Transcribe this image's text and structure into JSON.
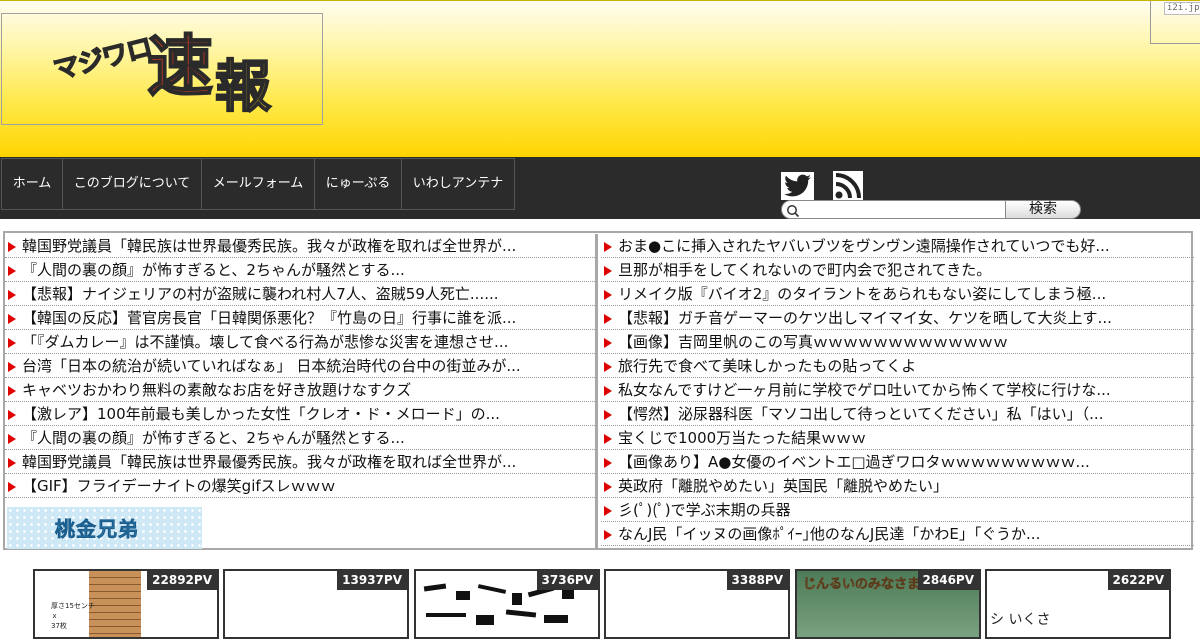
{
  "header": {
    "logo_small": "マジワロ",
    "logo_big1": "速",
    "logo_big2": "報",
    "corner_badge": "i2i.jp"
  },
  "nav": {
    "items": [
      "ホーム",
      "このブログについて",
      "メールフォーム",
      "にゅーぷる",
      "いわしアンテナ"
    ],
    "search_button": "検索",
    "search_placeholder": ""
  },
  "left_links": [
    "韓国野党議員「韓民族は世界最優秀民族。我々が政権を取れば全世界が...",
    "『人間の裏の顔』が怖すぎると、2ちゃんが騒然とする...",
    "【悲報】ナイジェリアの村が盗賊に襲われ村人7人、盗賊59人死亡......",
    "【韓国の反応】菅官房長官「日韓関係悪化？『竹島の日』行事に誰を派...",
    "「『ダムカレー』は不謹慎。壊して食べる行為が悲惨な災害を連想させ...",
    "台湾「日本の統治が続いていればなぁ」 日本統治時代の台中の街並みが...",
    "キャベツおかわり無料の素敵なお店を好き放題けなすクズ",
    "【激レア】100年前最も美しかった女性「クレオ・ド・メロード」の...",
    "『人間の裏の顔』が怖すぎると、2ちゃんが騒然とする...",
    "韓国野党議員「韓民族は世界最優秀民族。我々が政権を取れば全世界が...",
    "【GIF】フライデーナイトの爆笑gifスレｗｗｗ"
  ],
  "banner_text": "桃金兄弟",
  "right_links": [
    "おま●こに挿入されたヤバいブツをヴンヴン遠隔操作されていつでも好...",
    "旦那が相手をしてくれないので町内会で犯されてきた。",
    "リメイク版『バイオ2』のタイラントをあられもない姿にしてしまう極...",
    "【悲報】ガチ音ゲーマーのケツ出しマイマイ女、ケツを晒して大炎上す...",
    "【画像】吉岡里帆のこの写真ｗｗｗｗｗｗｗｗｗｗｗｗｗ",
    "旅行先で食べて美味しかったもの貼ってくよ",
    "私女なんですけど一ヶ月前に学校でゲロ吐いてから怖くて学校に行けな...",
    "【愕然】泌尿器科医「マソコ出して待っといてください」私「はい」（...",
    "宝くじで1000万当たった結果ｗｗｗ",
    "【画像あり】A●女優のイベントエ□過ぎワロタｗｗｗｗｗｗｗｗｗ...",
    "英政府「離脱やめたい」英国民「離脱やめたい」",
    "彡(ﾟ)(ﾟ)で学ぶ末期の兵器",
    "なんJ民「イッヌの画像ﾎﾟｲｰ｣他のなんJ民達「かわE」「ぐうか..."
  ],
  "thumbnails": [
    {
      "pv": "22892PV",
      "caption": "厚さ15センチ\nｘ\n37枚"
    },
    {
      "pv": "13937PV"
    },
    {
      "pv": "3736PV"
    },
    {
      "pv": "3388PV"
    },
    {
      "pv": "2846PV",
      "caption": "じんるいのみなさまへ"
    },
    {
      "pv": "2622PV",
      "caption": "シ いくさ"
    }
  ],
  "colors": {
    "header_top": "#fffdf0",
    "header_bottom": "#ffd400",
    "nav_bg": "#2b2b2b",
    "arrow": "#e00000"
  },
  "icons": [
    "twitter-icon",
    "rss-icon",
    "search-icon"
  ]
}
